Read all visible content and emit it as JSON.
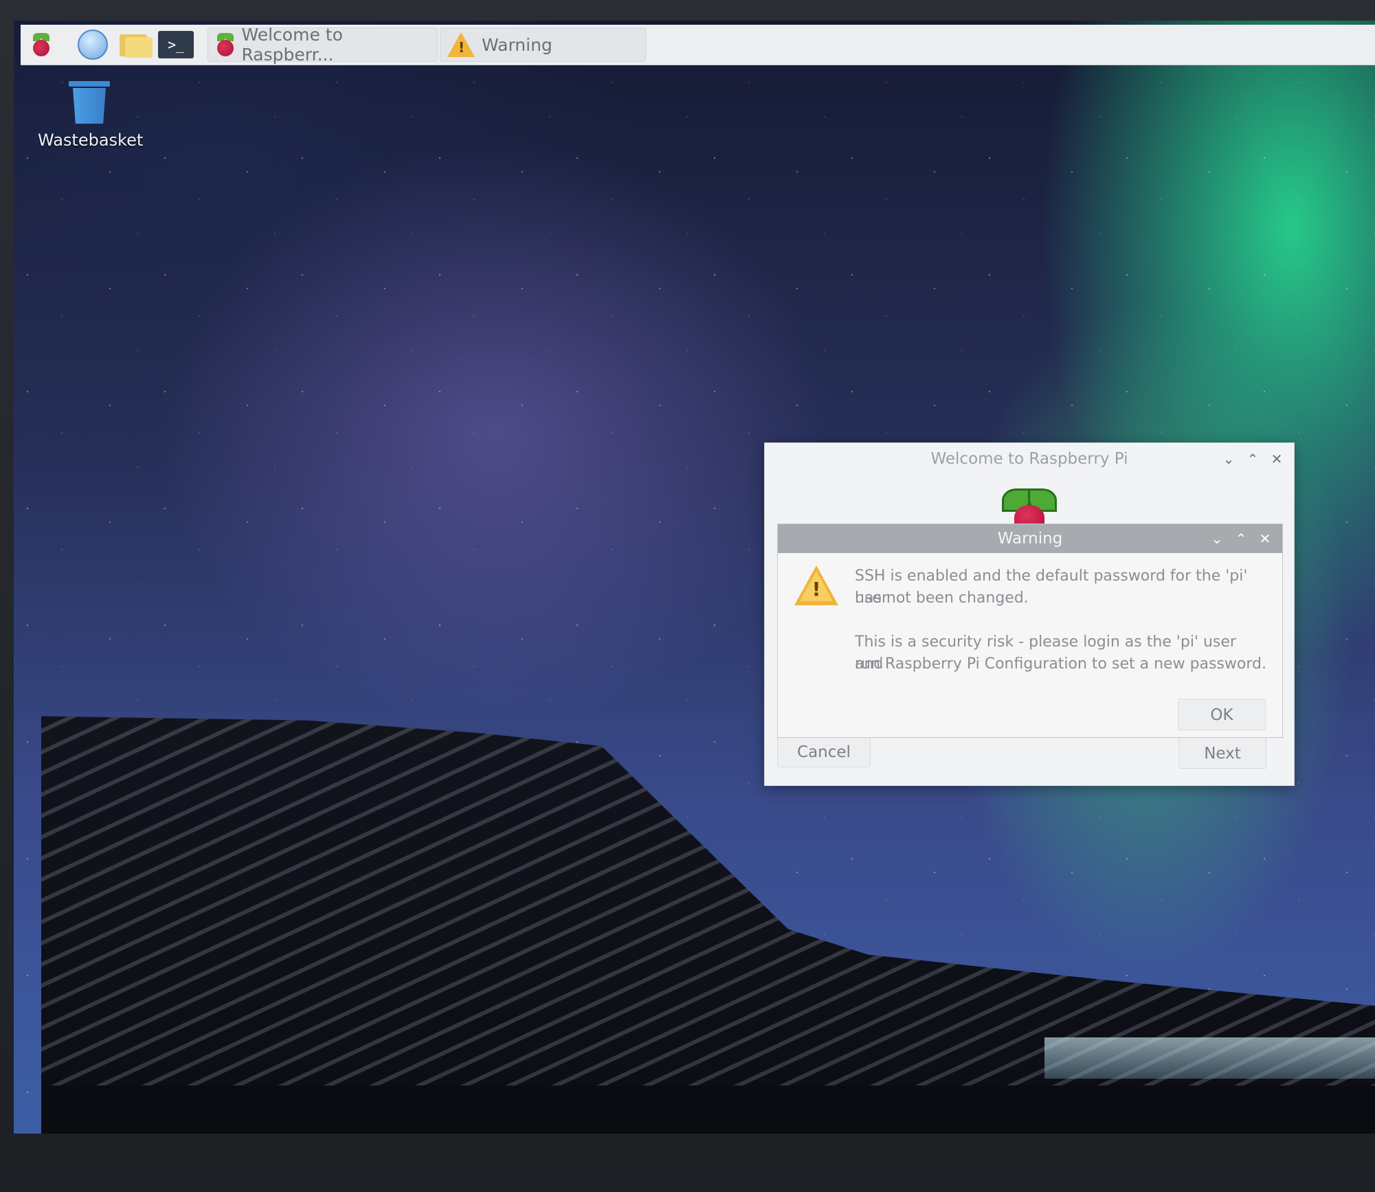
{
  "taskbar": {
    "menu_icon": "raspberry-icon",
    "launchers": [
      {
        "name": "web-browser",
        "icon": "globe-icon"
      },
      {
        "name": "file-manager",
        "icon": "folder-icon"
      },
      {
        "name": "terminal",
        "icon": "terminal-icon",
        "glyph": ">_"
      }
    ],
    "windows": [
      {
        "label": "Welcome to Raspberr...",
        "icon": "raspberry-icon"
      },
      {
        "label": "Warning",
        "icon": "warning-icon"
      }
    ]
  },
  "desktop": {
    "icons": [
      {
        "label": "Wastebasket",
        "icon": "wastebasket-icon"
      }
    ]
  },
  "welcome_dialog": {
    "title": "Welcome to Raspberry Pi",
    "controls": {
      "minimize": "⌄",
      "maximize": "⌃",
      "close": "✕"
    },
    "cancel_label": "Cancel",
    "next_label": "Next"
  },
  "warning_dialog": {
    "title": "Warning",
    "controls": {
      "minimize": "⌄",
      "maximize": "⌃",
      "close": "✕"
    },
    "message_line1": "SSH is enabled and the default password for the 'pi' user",
    "message_line2": "has not been changed.",
    "message_line3": "This is a security risk - please login as the 'pi' user and",
    "message_line4": "run Raspberry Pi Configuration to set a new password.",
    "ok_label": "OK"
  },
  "colors": {
    "taskbar_bg": "#eceef0",
    "warning_titlebar": "#a7abb0",
    "warning_icon": "#f1b338",
    "raspberry_red": "#c51a4a",
    "raspberry_leaf": "#4caa35"
  }
}
